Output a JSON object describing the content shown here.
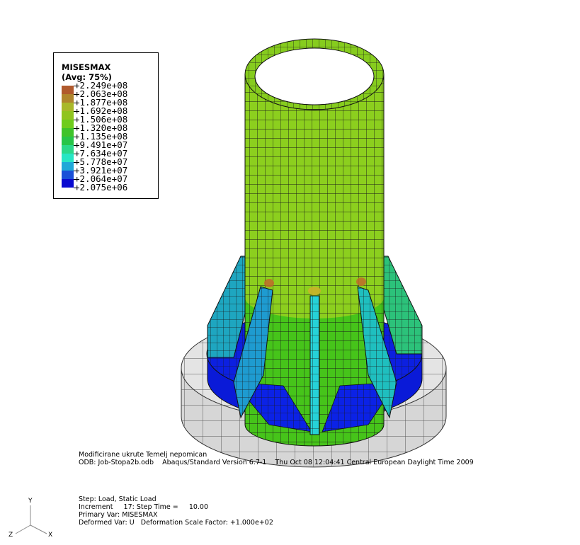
{
  "legend": {
    "variable": "MISESMAX",
    "averaging": "(Avg: 75%)",
    "levels": [
      "+2.249e+08",
      "+2.063e+08",
      "+1.877e+08",
      "+1.692e+08",
      "+1.506e+08",
      "+1.320e+08",
      "+1.135e+08",
      "+9.491e+07",
      "+7.634e+07",
      "+5.778e+07",
      "+3.921e+07",
      "+2.064e+07",
      "+2.075e+06"
    ],
    "colors": [
      "#b05a2d",
      "#b0862d",
      "#a9b82a",
      "#90c41f",
      "#6fcc1c",
      "#3fc32a",
      "#27c548",
      "#2bd98a",
      "#27e6c4",
      "#1fa8d8",
      "#1a50d8",
      "#0a0ad0"
    ]
  },
  "info": {
    "model_title": "Modificirane ukrute Temelj nepomican",
    "odb_line": "ODB: Job-Stopa2b.odb    Abaqus/Standard Version 6.7-1    Thu Oct 08 12:04:41 Central European Daylight Time 2009",
    "step_line": "Step: Load, Static Load",
    "increment_line": "Increment     17: Step Time =     10.00",
    "primary_var_line": "Primary Var: MISESMAX",
    "deformed_var_line": "Deformed Var: U   Deformation Scale Factor: +1.000e+02"
  },
  "triad": {
    "y": "Y",
    "z": "Z",
    "x": "X"
  }
}
